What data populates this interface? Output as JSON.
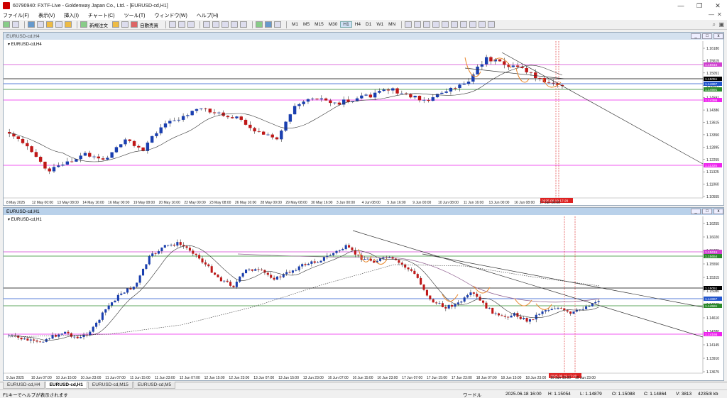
{
  "window": {
    "title": "60790940: FXTF-Live - Goldenway Japan Co., Ltd. - [EURUSD-cd,H1]"
  },
  "menu": {
    "items": [
      "ファイル(F)",
      "表示(V)",
      "挿入(I)",
      "チャート(C)",
      "ツール(T)",
      "ウィンドウ(W)",
      "ヘルプ(H)"
    ]
  },
  "toolbar": {
    "new_order": "新規注文",
    "auto_trade": "自動売買",
    "timeframes": [
      "M1",
      "M5",
      "M15",
      "M30",
      "H1",
      "H4",
      "D1",
      "W1",
      "MN"
    ],
    "active_timeframe": "H1"
  },
  "windows": [
    {
      "title": "EURUSD-cd,H4",
      "label": "EURUSD-cd,H4",
      "price_ticks": [
        "1.16180",
        "1.15915",
        "1.15650",
        "1.15385",
        "1.15120",
        "1.14855",
        "1.14590",
        "1.14325",
        "1.14060",
        "1.13615",
        "1.13350",
        "1.13085",
        "1.12820",
        "1.12555",
        "1.12290",
        "1.12025",
        "1.11760",
        "1.11495",
        "1.11230",
        "1.10965",
        "1.10700",
        "1.10555"
      ],
      "price_tick_labels": [
        "1.16180",
        "1.15615",
        "1.15051",
        "1.14867",
        "1.14591",
        "1.14386",
        "1.13615",
        "1.13350",
        "1.12895",
        "1.12255",
        "1.11325",
        "1.11060",
        "1.10555"
      ],
      "boxes": [
        {
          "label": "1.15615",
          "color": "#d040d0"
        },
        {
          "label": "1.15051",
          "color": "#000000"
        },
        {
          "label": "1.14867",
          "color": "#2255cc"
        },
        {
          "label": "1.14591",
          "color": "#2a8a2a"
        },
        {
          "label": "1.14386",
          "color": "#ee22ee"
        },
        {
          "label": "1.11325",
          "color": "#ee22ee"
        }
      ],
      "time_labels": [
        "8 May 2025",
        "12 May 00:00",
        "13 May 08:00",
        "14 May 16:00",
        "16 May 00:00",
        "19 May 08:00",
        "20 May 16:00",
        "22 May 00:00",
        "23 May 08:00",
        "26 May 16:00",
        "28 May 00:00",
        "29 May 08:00",
        "30 May 16:00",
        "3 Jun 00:00",
        "4 Jun 08:00",
        "5 Jun 16:00",
        "9 Jun 00:00",
        "10 Jun 08:00",
        "11 Jun 16:00",
        "13 Jun 00:00",
        "16 Jun 08:00",
        "17 Jun 16:00"
      ],
      "time_marker": "2025.06.19 17:29"
    },
    {
      "title": "EURUSD-cd,H1",
      "label": "EURUSD-cd,H1",
      "price_tick_labels": [
        "1.16255",
        "1.16020",
        "1.15785",
        "1.15550",
        "1.15315",
        "1.15080",
        "1.14845",
        "1.14610",
        "1.14380",
        "1.14145",
        "1.13910",
        "1.13675"
      ],
      "boxes": [
        {
          "label": "1.15615",
          "color": "#d040d0"
        },
        {
          "label": "1.15654",
          "color": "#2a8a2a"
        },
        {
          "label": "1.15051",
          "color": "#000000"
        },
        {
          "label": "1.14867",
          "color": "#2255cc"
        },
        {
          "label": "1.14591",
          "color": "#2a8a2a"
        },
        {
          "label": "1.14166",
          "color": "#ee22ee"
        }
      ],
      "time_labels": [
        "9 Jun 2025",
        "10 Jun 07:00",
        "10 Jun 15:00",
        "10 Jun 23:00",
        "11 Jun 07:00",
        "11 Jun 15:00",
        "11 Jun 23:00",
        "12 Jun 07:00",
        "12 Jun 15:00",
        "12 Jun 23:00",
        "13 Jun 07:00",
        "13 Jun 15:00",
        "13 Jun 23:00",
        "16 Jun 07:00",
        "16 Jun 15:00",
        "16 Jun 23:00",
        "17 Jun 07:00",
        "17 Jun 15:00",
        "17 Jun 23:00",
        "18 Jun 07:00",
        "18 Jun 15:00",
        "18 Jun 23:00",
        "19 Jun 15:00",
        "19 Jun 23:00"
      ],
      "time_marker": "2025.06.19 17:29"
    }
  ],
  "tabs": [
    "EURUSD-cd,H4",
    "EURUSD-cd,H1",
    "EURUSD-cd,M15",
    "EURUSD-cd,M5"
  ],
  "active_tab": 1,
  "status": {
    "help": "F1キーでヘルプが表示されます",
    "profile": "ワードル",
    "datetime": "2025.06.18 16:00",
    "high": "H: 1.15054",
    "low": "L: 1.14879",
    "open": "O: 1.15088",
    "close": "C: 1.14864",
    "volume": "V: 3813",
    "traffic": "4235/8 kb"
  }
}
